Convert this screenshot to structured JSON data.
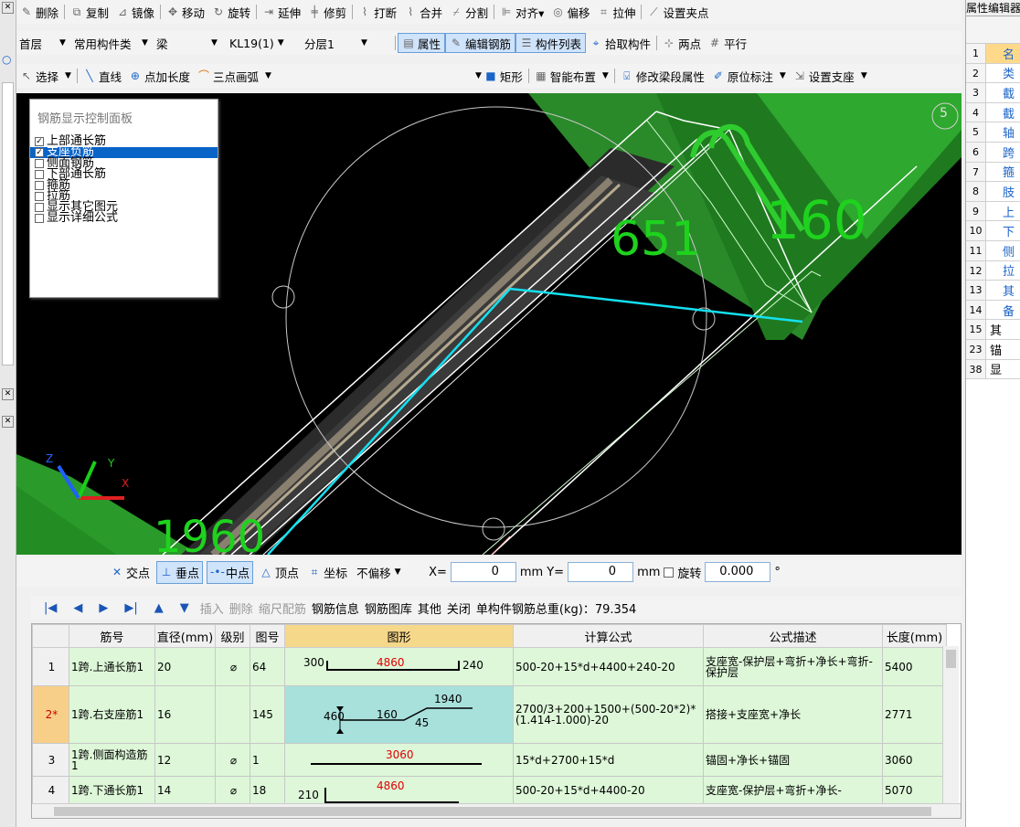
{
  "toolbar1": {
    "items": [
      "删除",
      "复制",
      "镜像",
      "移动",
      "旋转",
      "延伸",
      "修剪",
      "打断",
      "合并",
      "分割",
      "对齐▾",
      "偏移",
      "拉伸",
      "设置夹点"
    ]
  },
  "toolbar2": {
    "floor": "首层",
    "category": "常用构件类",
    "type": "梁",
    "component": "KL19(1)",
    "layer": "分层1",
    "btn_properties": "属性",
    "btn_edit_rebar": "编辑钢筋",
    "btn_component_list": "构件列表",
    "btn_pick": "拾取构件",
    "btn_two_points": "两点",
    "btn_parallel": "平行"
  },
  "toolbar3": {
    "select": "选择",
    "line": "直线",
    "point_add_length": "点加长度",
    "three_point_arc": "三点画弧",
    "rect": "矩形",
    "smart_layout": "智能布置",
    "modify_beam_prop": "修改梁段属性",
    "inplace_label": "原位标注",
    "set_support": "设置支座"
  },
  "viewport": {
    "panel_title": "钢筋显示控制面板",
    "options": [
      {
        "label": "上部通长筋",
        "checked": true,
        "selected": false
      },
      {
        "label": "支座负筋",
        "checked": true,
        "selected": true
      },
      {
        "label": "侧面钢筋",
        "checked": false,
        "selected": false
      },
      {
        "label": "下部通长筋",
        "checked": false,
        "selected": false
      },
      {
        "label": "箍筋",
        "checked": false,
        "selected": false
      },
      {
        "label": "拉筋",
        "checked": false,
        "selected": false
      },
      {
        "label": "显示其它图元",
        "checked": false,
        "selected": false
      },
      {
        "label": "显示详细公式",
        "checked": false,
        "selected": false
      }
    ],
    "dim_651": "651",
    "dim_160": "160",
    "dim_1960": "1960",
    "axis_label": "5",
    "axis_x": "X",
    "axis_y": "Y",
    "axis_z": "Z"
  },
  "snapbar": {
    "intersect": "交点",
    "perp": "垂点",
    "mid": "中点",
    "vertex": "顶点",
    "coord": "坐标",
    "offset": "不偏移",
    "x_label": "X=",
    "x_value": "0",
    "mm1": "mm",
    "y_label": "Y=",
    "y_value": "0",
    "mm2": "mm",
    "rotate_label": "旋转",
    "rotate_value": "0.000",
    "deg": "°"
  },
  "gridbar": {
    "insert": "插入",
    "delete": "删除",
    "ruler": "缩尺配筋",
    "rebar_info": "钢筋信息",
    "rebar_lib": "钢筋图库",
    "other": "其他",
    "close": "关闭",
    "total_weight": "单构件钢筋总重(kg)：79.354"
  },
  "grid": {
    "columns": [
      "筋号",
      "直径(mm)",
      "级别",
      "图号",
      "图形",
      "计算公式",
      "公式描述",
      "长度(mm)"
    ],
    "rows": [
      {
        "rn": "1",
        "name": "1跨.上通长筋1",
        "dia": "20",
        "grade": "⌀",
        "fig": "64",
        "formula": "500-20+15*d+4400+240-20",
        "desc": "支座宽-保护层+弯折+净长+弯折-保护层",
        "len": "5400",
        "s_left": "300",
        "s_mid": "4860",
        "s_right": "240"
      },
      {
        "rn": "2*",
        "name": "1跨.右支座筋1",
        "dia": "16",
        "grade": "",
        "fig": "145",
        "formula": "2700/3+200+1500+(500-20*2)*(1.414-1.000)-20",
        "desc": "搭接+支座宽+净长",
        "len": "2771",
        "s_a": "1940",
        "s_b": "460",
        "s_c": "160",
        "s_d": "45"
      },
      {
        "rn": "3",
        "name": "1跨.侧面构造筋1",
        "dia": "12",
        "grade": "⌀",
        "fig": "1",
        "formula": "15*d+2700+15*d",
        "desc": "锚固+净长+锚固",
        "len": "3060",
        "s_mid": "3060"
      },
      {
        "rn": "4",
        "name": "1跨.下通长筋1",
        "dia": "14",
        "grade": "⌀",
        "fig": "18",
        "formula": "500-20+15*d+4400-20",
        "desc": "支座宽-保护层+弯折+净长-",
        "len": "5070",
        "s_left": "210",
        "s_mid": "4860"
      }
    ]
  },
  "rightpanel": {
    "title": "属性编辑器",
    "rows": [
      "1",
      "2",
      "3",
      "4",
      "5",
      "6",
      "7",
      "8",
      "9",
      "10",
      "11",
      "12",
      "13",
      "14",
      "15",
      "23",
      "38"
    ],
    "chars": [
      "名",
      "类",
      "截",
      "截",
      "轴",
      "跨",
      "箍",
      "肢",
      "上",
      "下",
      "侧",
      "拉",
      "其",
      "备",
      "其",
      "锚",
      "显"
    ]
  }
}
